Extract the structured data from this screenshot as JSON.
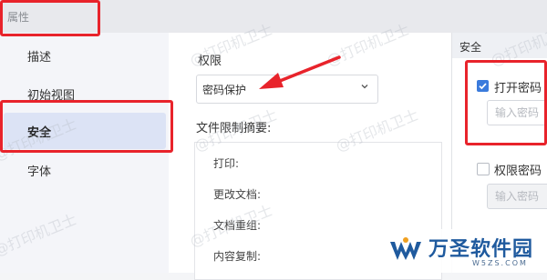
{
  "window": {
    "title": "属性"
  },
  "sidebar": {
    "items": [
      {
        "label": "描述"
      },
      {
        "label": "初始视图"
      },
      {
        "label": "安全"
      },
      {
        "label": "字体"
      }
    ]
  },
  "main": {
    "permissions_label": "权限",
    "permission_select_value": "密码保护",
    "summary_label": "文件限制摘要:",
    "summary_rows": [
      {
        "label": "打印:"
      },
      {
        "label": "更改文档:"
      },
      {
        "label": "文档重组:"
      },
      {
        "label": "内容复制:"
      }
    ]
  },
  "security_panel": {
    "title": "安全",
    "open_password_label": "打开密码",
    "open_password_checked": true,
    "open_password_placeholder": "输入密码",
    "permission_password_label": "权限密码",
    "permission_password_checked": false,
    "permission_password_placeholder": "输入密码"
  },
  "watermark": {
    "text": "@打印机卫士"
  },
  "logo": {
    "brand": "万圣软件园",
    "sub": "W5ZS.COM"
  },
  "colors": {
    "highlight": "#e8232b",
    "accent": "#3b7bdc",
    "active_nav": "#dce3f5"
  }
}
